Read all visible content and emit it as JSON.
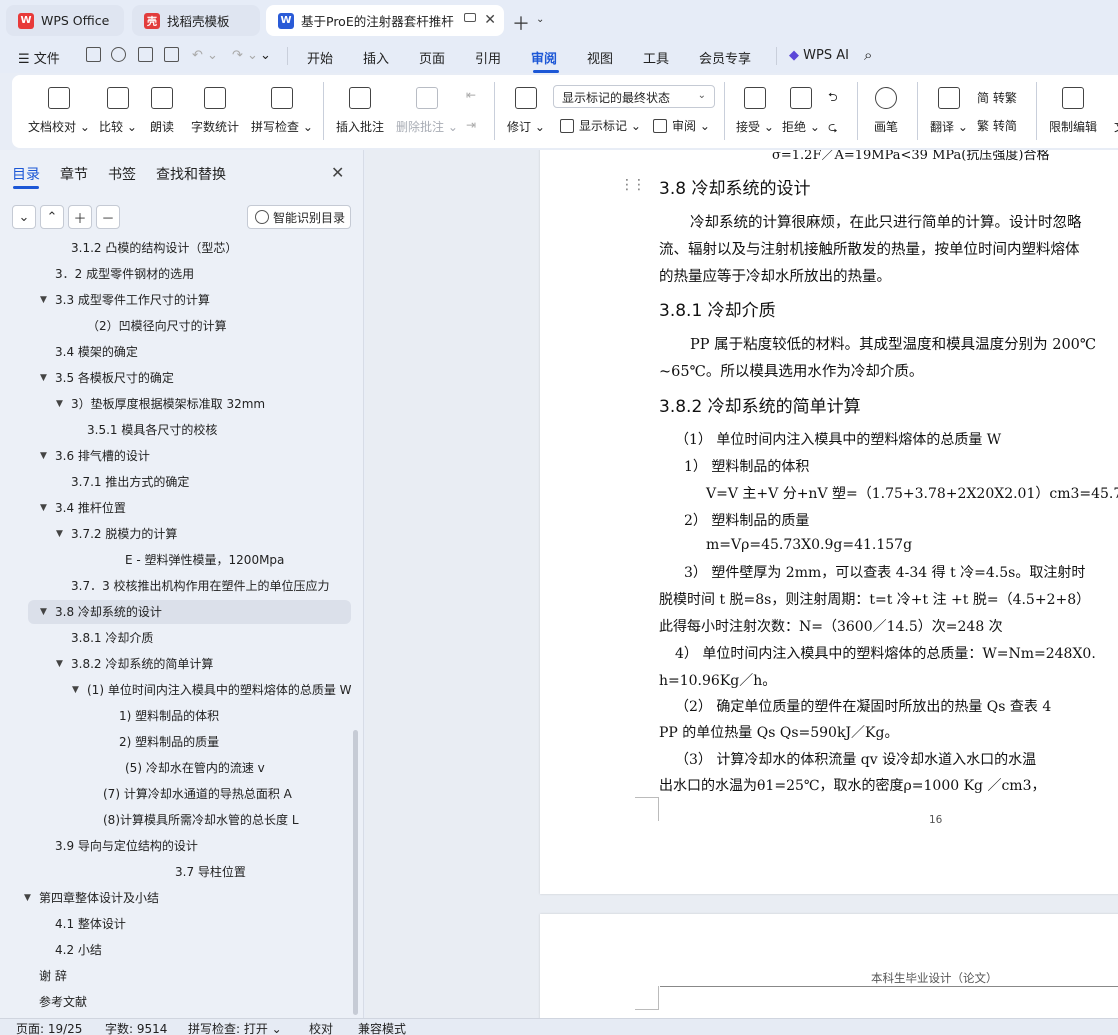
{
  "tabs": [
    {
      "label": "WPS Office",
      "icon": "wps-logo-icon",
      "color": "#e83a3a",
      "glyph": "W"
    },
    {
      "label": "找稻壳模板",
      "icon": "docer-icon",
      "color": "#e23c3c",
      "glyph": "壳"
    },
    {
      "label": "基于ProE的注射器套杆推杆注塑模设计",
      "icon": "word-doc-icon",
      "color": "#2a5bd7",
      "glyph": "W"
    }
  ],
  "menu": {
    "file": "文件",
    "items": [
      "开始",
      "插入",
      "页面",
      "引用",
      "审阅",
      "视图",
      "工具",
      "会员专享"
    ],
    "active": "审阅",
    "ai": "WPS AI"
  },
  "ribbon": {
    "buttons": [
      {
        "label": "文档校对",
        "dd": true
      },
      {
        "label": "比较",
        "dd": true
      },
      {
        "label": "朗读",
        "dd": false
      },
      {
        "label": "字数统计",
        "dd": false
      },
      {
        "label": "拼写检查",
        "dd": true
      },
      {
        "label": "插入批注",
        "dd": false
      },
      {
        "label": "删除批注",
        "dd": true
      },
      {
        "label": "修订",
        "dd": true
      },
      {
        "label": "接受",
        "dd": true
      },
      {
        "label": "拒绝",
        "dd": true
      },
      {
        "label": "画笔",
        "dd": false
      },
      {
        "label": "翻译",
        "dd": true
      },
      {
        "label": "限制编辑",
        "dd": false
      },
      {
        "label": "文",
        "dd": false
      }
    ],
    "markup_select": "显示标记的最终状态",
    "show_markup": "显示标记",
    "review": "审阅",
    "to_trad": "简 转繁",
    "to_simp": "繁 转简"
  },
  "nav": {
    "tabs": [
      "目录",
      "章节",
      "书签",
      "查找和替换"
    ],
    "active_tab": "目录",
    "smart_toc": "智能识别目录",
    "toc": [
      {
        "text": "3.1.2 凸模的结构设计（型芯）",
        "level": 3,
        "caret": ""
      },
      {
        "text": "3．2 成型零件钢材的选用",
        "level": 2,
        "caret": ""
      },
      {
        "text": "3.3 成型零件工作尺寸的计算",
        "level": 2,
        "caret": "down"
      },
      {
        "text": "（2）凹模径向尺寸的计算",
        "level": 4,
        "caret": ""
      },
      {
        "text": "3.4 模架的确定",
        "level": 2,
        "caret": ""
      },
      {
        "text": "3.5 各模板尺寸的确定",
        "level": 2,
        "caret": "down"
      },
      {
        "text": "3）垫板厚度根据模架标准取 32mm",
        "level": 3,
        "caret": "down"
      },
      {
        "text": "3.5.1 模具各尺寸的校核",
        "level": 4,
        "caret": ""
      },
      {
        "text": "3.6 排气槽的设计",
        "level": 2,
        "caret": "down"
      },
      {
        "text": "3.7.1 推出方式的确定",
        "level": 3,
        "caret": ""
      },
      {
        "text": "3.4 推杆位置",
        "level": 2,
        "caret": "down"
      },
      {
        "text": "3.7.2 脱模力的计算",
        "level": 3,
        "caret": "down"
      },
      {
        "text": "E - 塑料弹性模量，1200Mpa",
        "level": 5,
        "caret": ""
      },
      {
        "text": "3.7．3 校核推出机构作用在塑件上的单位压应力",
        "level": 3,
        "caret": ""
      },
      {
        "text": "3.8  冷却系统的设计",
        "level": 2,
        "caret": "down",
        "selected": true
      },
      {
        "text": "3.8.1 冷却介质",
        "level": 3,
        "caret": ""
      },
      {
        "text": "3.8.2 冷却系统的简单计算",
        "level": 3,
        "caret": "down"
      },
      {
        "text": "(1)   单位时间内注入模具中的塑料熔体的总质量 W",
        "level": 4,
        "caret": "down"
      },
      {
        "text": "1)     塑料制品的体积",
        "level": 6,
        "caret": ""
      },
      {
        "text": "2)     塑料制品的质量",
        "level": 6,
        "caret": ""
      },
      {
        "text": "(5)     冷却水在管内的流速 v",
        "level": 5,
        "caret": ""
      },
      {
        "text": "(7)   计算冷却水通道的导热总面积 A",
        "level": 5,
        "caret": ""
      },
      {
        "text": "(8)计算模具所需冷却水管的总长度 L",
        "level": 5,
        "caret": ""
      },
      {
        "text": "3.9 导向与定位结构的设计",
        "level": 2,
        "caret": ""
      },
      {
        "text": "3.7 导柱位置",
        "level": 6,
        "caret": ""
      },
      {
        "text": "第四章整体设计及小结",
        "level": 1,
        "caret": "down"
      },
      {
        "text": "4.1 整体设计",
        "level": 2,
        "caret": ""
      },
      {
        "text": "4.2 小结",
        "level": 2,
        "caret": ""
      },
      {
        "text": "谢  辞",
        "level": 1,
        "caret": ""
      },
      {
        "text": "参考文献",
        "level": 1,
        "caret": ""
      }
    ]
  },
  "doc": {
    "top_partial": "σ=1.2F／A=19MPa<39  MPa(抗压强度)合格",
    "h_38": "3.8  冷却系统的设计",
    "p1_l1": "冷却系统的计算很麻烦，在此只进行简单的计算。设计时忽略",
    "p1_l2": "流、辐射以及与注射机接触所散发的热量，按单位时间内塑料熔体",
    "p1_l3": "的热量应等于冷却水所放出的热量。",
    "h_381": "3.8.1 冷却介质",
    "p2_l1": "PP 属于粘度较低的材料。其成型温度和模具温度分别为 200℃",
    "p2_l2": "~65℃。所以模具选用水作为冷却介质。",
    "h_382": "3.8.2 冷却系统的简单计算",
    "c1": "（1）  单位时间内注入模具中的塑料熔体的总质量 W",
    "c2": "1）   塑料制品的体积",
    "c3": "V=V 主+V 分+nV 塑=（1.75+3.78+2X20X2.01）cm3=45.73cm3",
    "c4": "2）   塑料制品的质量",
    "c5": "m=Vρ=45.73X0.9g=41.157g",
    "c6": "3）   塑件壁厚为 2mm，可以查表 4-34 得 t 冷=4.5s。取注射时",
    "c7": "脱模时间 t 脱=8s，则注射周期：t=t 冷+t 注  +t 脱=（4.5+2+8）",
    "c8": "此得每小时注射次数：N=（3600／14.5）次=248 次",
    "c9": "4）  单位时间内注入模具中的塑料熔体的总质量：W=Nm=248X0.",
    "c10": "h=10.96Kg／h。",
    "c11": "（2）   确定单位质量的塑件在凝固时所放出的热量 Qs   查表 4",
    "c12": "PP 的单位热量 Qs Qs=590kJ／Kg。",
    "c13": "（3）  计算冷却水的体积流量 qv     设冷却水道入水口的水温",
    "c14": "出水口的水温为θ1=25℃，取水的密度ρ=1000  Kg  ／cm3，",
    "page_number": "16",
    "next_header": "本科生毕业设计（论文）"
  },
  "status": {
    "page": "页面: 19/25",
    "words": "字数: 9514",
    "spell": "拼写检查: 打开",
    "proof": "校对",
    "compat": "兼容模式"
  }
}
